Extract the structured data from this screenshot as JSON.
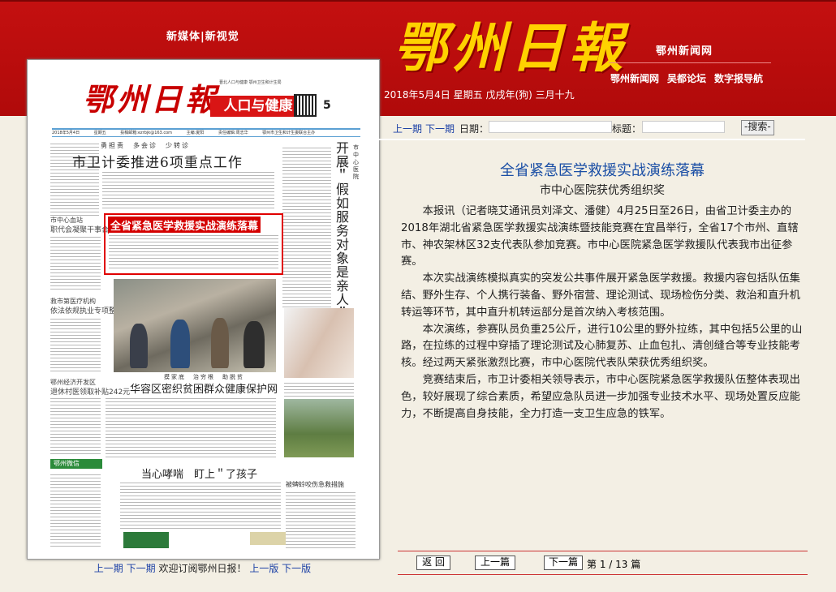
{
  "header": {
    "media_label": "新媒体|新视觉",
    "logo_text": "鄂州日報",
    "site_name": "鄂州新闻网",
    "nav": [
      "鄂州新闻网",
      "吴都论坛",
      "数字报导航"
    ],
    "date": "2018年5月4日 星期五 戊戌年(狗) 三月十九"
  },
  "newspaper": {
    "logo": "鄂州日報",
    "section_badge": "人口与健康",
    "page_no": "5",
    "sub_label": "晋北人口与健康 鄂州卫生和计生局",
    "info": [
      "2018年5月4日",
      "星期五",
      "投稿邮箱:ezrbjk@163.com",
      "主编:夏阳",
      "责任编辑:周志华",
      "鄂州市卫生和计生委联合主办"
    ],
    "slogan": "勇担责　多会诊　少转诊",
    "headline": "市卫计委推进6项重点工作",
    "highlight_title": "全省紧急医学救援实战演练落幕",
    "side_vertical": "开展＂假如服务对象是亲人＂大讨论",
    "side_vertical_small": "市中心医院",
    "sub_heads": [
      "市中心血站",
      "职代会凝聚干事合力",
      "救市第医疗机构",
      "依法依规执业专项整治",
      "鄂州经济开发区",
      "退休村医领取补贴242元"
    ],
    "mid_slogan": "摸家底　治穷根　助脱贫",
    "mid_headline": "华容区密织贫困群众健康保护网",
    "bottom_headline": "当心哮喘　盯上＂了孩子",
    "side_small_head": "被蜱蛉咬伤急救措施",
    "wechat": "鄂州微信"
  },
  "left_nav": {
    "prev": "上一期",
    "next": "下一期",
    "welcome": "欢迎订阅鄂州日报！",
    "prev_page": "上一版",
    "next_page": "下一版"
  },
  "toolbar": {
    "prev": "上一期",
    "next": "下一期",
    "date_label": "日期：",
    "date_value": "",
    "title_label": "标题：",
    "title_value": "",
    "search": "-搜索-"
  },
  "article": {
    "title": "全省紧急医学救援实战演练落幕",
    "subtitle": "市中心医院获优秀组织奖",
    "paragraphs": [
      "本报讯（记者晓艾通讯员刘泽文、潘健）4月25日至26日，由省卫计委主办的2018年湖北省紧急医学救援实战演练暨技能竞赛在宜昌举行，全省17个市州、直辖市、神农架林区32支代表队参加竞赛。市中心医院紧急医学救援队代表我市出征参赛。",
      "本次实战演练模拟真实的突发公共事件展开紧急医学救援。救援内容包括队伍集结、野外生存、个人携行装备、野外宿营、理论测试、现场检伤分类、救治和直升机转运等环节，其中直升机转运部分是首次纳入考核范围。",
      "本次演练，参赛队员负重25公斤，进行10公里的野外拉练，其中包括5公里的山路，在拉练的过程中穿插了理论测试及心肺复苏、止血包扎、清创缝合等专业技能考核。经过两天紧张激烈比赛，市中心医院代表队荣获优秀组织奖。",
      "竞赛结束后，市卫计委相关领导表示，市中心医院紧急医学救援队伍整体表现出色，较好展现了综合素质，希望应急队员进一步加强专业技术水平、现场处置反应能力，不断提高自身技能，全力打造一支卫生应急的铁军。"
    ]
  },
  "bottom_bar": {
    "back": "返 回",
    "prev_article": "上一篇",
    "next_article": "下一篇",
    "page_info": "第 1 / 13 篇"
  },
  "colors": {
    "header_red": "#b00a0a",
    "logo_yellow": "#ffd200",
    "link_blue": "#1a3fa5",
    "title_blue": "#1a4ea5"
  }
}
